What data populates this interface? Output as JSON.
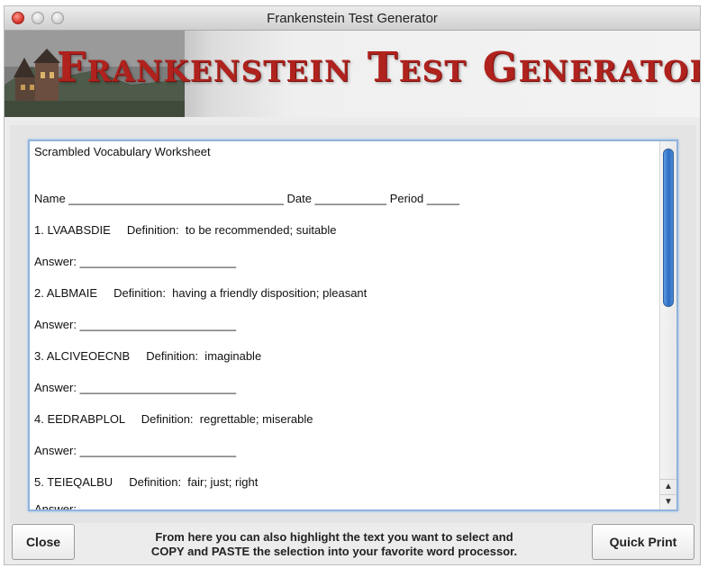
{
  "window": {
    "title": "Frankenstein Test Generator"
  },
  "banner": {
    "title": "Frankenstein Test Generator"
  },
  "worksheet": {
    "heading": "Scrambled Vocabulary Worksheet",
    "name_line": "Name _________________________________ Date ___________ Period _____",
    "items": [
      {
        "question": "1. LVAABSDIE     Definition:  to be recommended; suitable",
        "answer": "Answer: ________________________"
      },
      {
        "question": "2. ALBMAIE     Definition:  having a friendly disposition; pleasant",
        "answer": "Answer: ________________________"
      },
      {
        "question": "3. ALCIVEOECNB     Definition:  imaginable",
        "answer": "Answer: ________________________"
      },
      {
        "question": "4. EEDRABPLOL     Definition:  regrettable; miserable",
        "answer": "Answer: ________________________"
      },
      {
        "question": "5. TEIEQALBU     Definition:  fair; just; right",
        "answer": "Answer: ________________________"
      }
    ]
  },
  "footer": {
    "close_label": "Close",
    "help_line1": "From here you can also highlight the text you want to select and",
    "help_line2": "COPY and PASTE the selection into your favorite word processor.",
    "print_label": "Quick Print"
  },
  "colors": {
    "banner_text": "#b0221d",
    "scroll_thumb": "#2b6cc4",
    "text_area_border": "#8fb3dd"
  }
}
